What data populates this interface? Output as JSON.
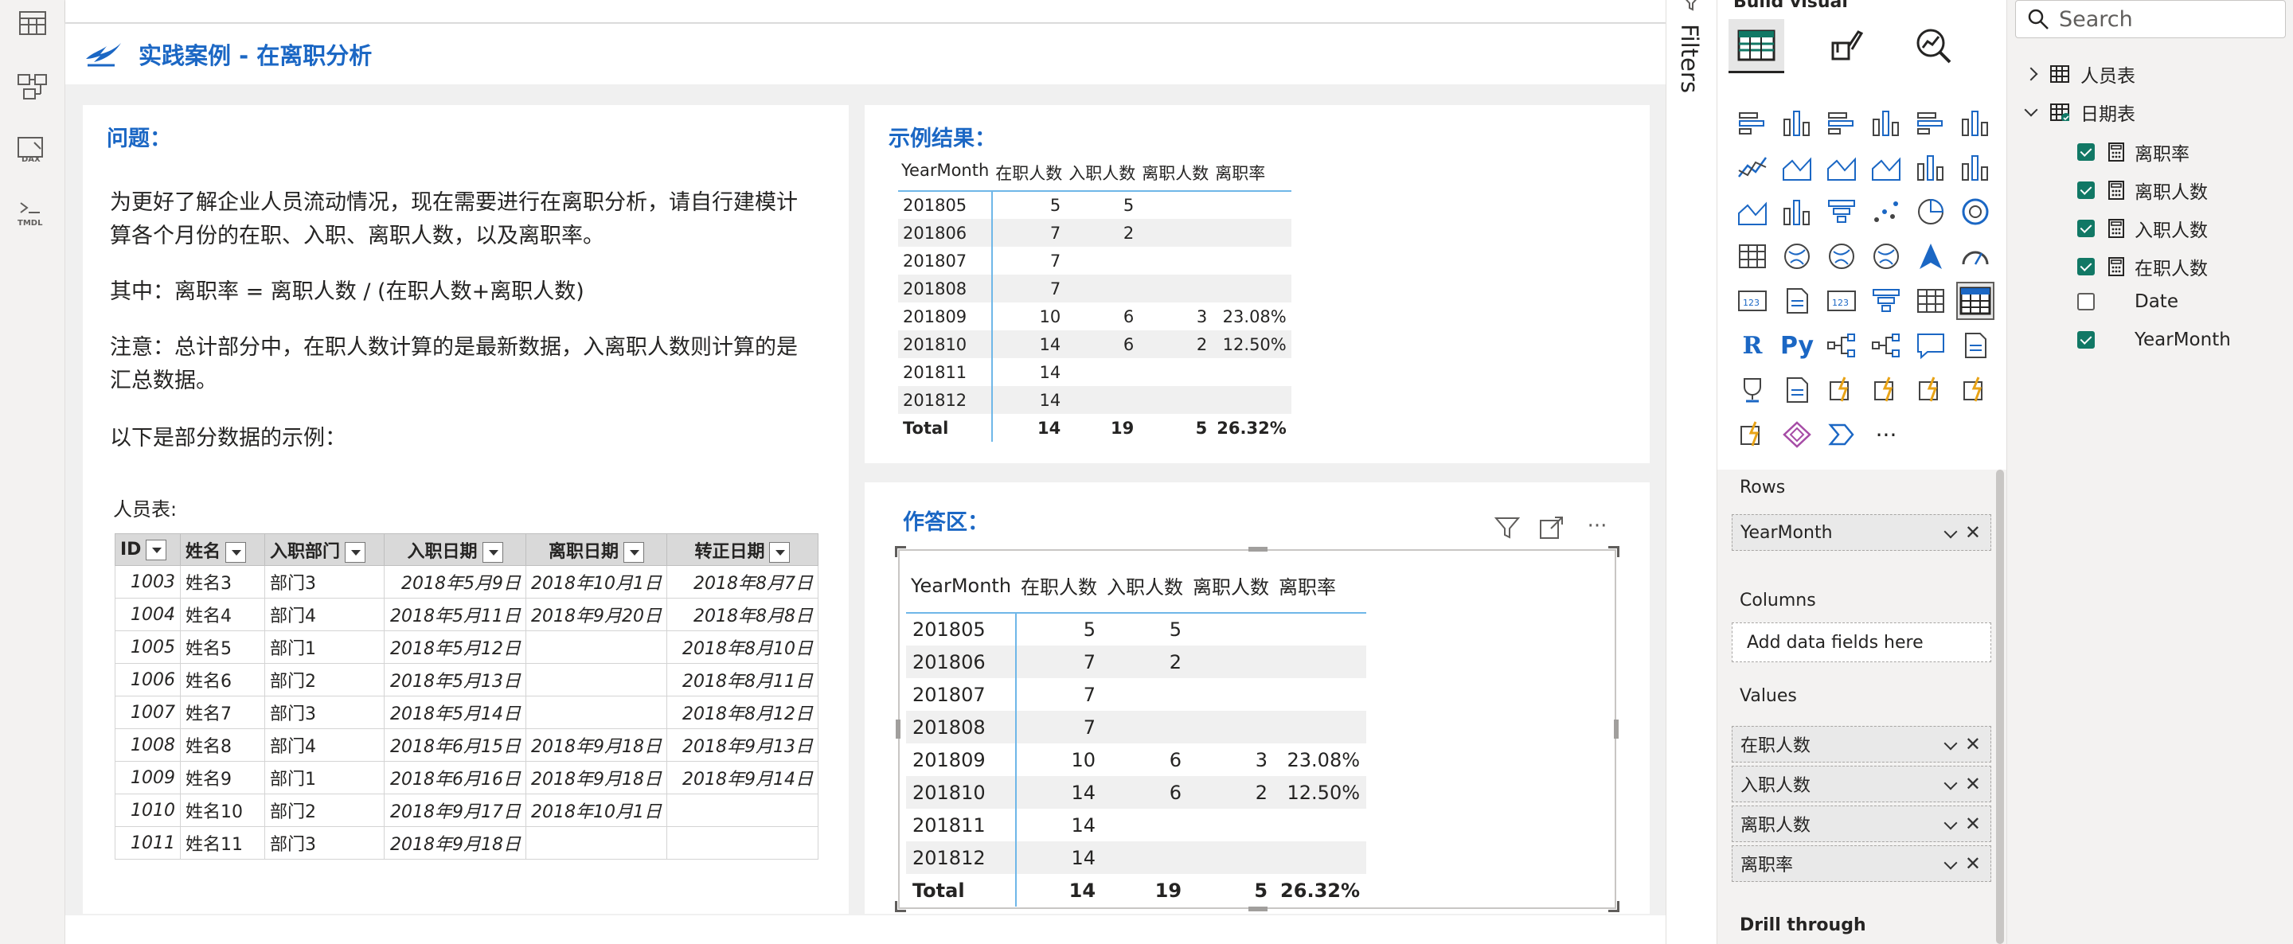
{
  "page": {
    "title": "实践案例 - 在离职分析"
  },
  "question": {
    "title": "问题：",
    "p1": "为更好了解企业人员流动情况，现在需要进行在离职分析，请自行建模计算各个月份的在职、入职、离职人数，以及离职率。",
    "p2": "其中：离职率 = 离职人数 / (在职人数+离职人数)",
    "p3": "注意：总计部分中，在职人数计算的是最新数据，入离职人数则计算的是汇总数据。",
    "p4": "以下是部分数据的示例：",
    "emp_caption": "人员表:",
    "emp_headers": [
      "ID",
      "姓名",
      "入职部门",
      "入职日期",
      "离职日期",
      "转正日期"
    ],
    "emp_rows": [
      [
        "1003",
        "姓名3",
        "部门3",
        "2018年5月9日",
        "2018年10月1日",
        "2018年8月7日"
      ],
      [
        "1004",
        "姓名4",
        "部门4",
        "2018年5月11日",
        "2018年9月20日",
        "2018年8月8日"
      ],
      [
        "1005",
        "姓名5",
        "部门1",
        "2018年5月12日",
        "",
        "2018年8月10日"
      ],
      [
        "1006",
        "姓名6",
        "部门2",
        "2018年5月13日",
        "",
        "2018年8月11日"
      ],
      [
        "1007",
        "姓名7",
        "部门3",
        "2018年5月14日",
        "",
        "2018年8月12日"
      ],
      [
        "1008",
        "姓名8",
        "部门4",
        "2018年6月15日",
        "2018年9月18日",
        "2018年9月13日"
      ],
      [
        "1009",
        "姓名9",
        "部门1",
        "2018年6月16日",
        "2018年9月18日",
        "2018年9月14日"
      ],
      [
        "1010",
        "姓名10",
        "部门2",
        "2018年9月17日",
        "2018年10月1日",
        ""
      ],
      [
        "1011",
        "姓名11",
        "部门3",
        "2018年9月18日",
        "",
        ""
      ]
    ]
  },
  "sample": {
    "title": "示例结果：",
    "headers": [
      "YearMonth",
      "在职人数",
      "入职人数",
      "离职人数",
      "离职率"
    ],
    "rows": [
      [
        "201805",
        "5",
        "5",
        "",
        ""
      ],
      [
        "201806",
        "7",
        "2",
        "",
        ""
      ],
      [
        "201807",
        "7",
        "",
        "",
        ""
      ],
      [
        "201808",
        "7",
        "",
        "",
        ""
      ],
      [
        "201809",
        "10",
        "6",
        "3",
        "23.08%"
      ],
      [
        "201810",
        "14",
        "6",
        "2",
        "12.50%"
      ],
      [
        "201811",
        "14",
        "",
        "",
        ""
      ],
      [
        "201812",
        "14",
        "",
        "",
        ""
      ]
    ],
    "total": [
      "Total",
      "14",
      "19",
      "5",
      "26.32%"
    ]
  },
  "answer": {
    "title": "作答区：",
    "headers": [
      "YearMonth",
      "在职人数",
      "入职人数",
      "离职人数",
      "离职率"
    ],
    "rows": [
      [
        "201805",
        "5",
        "5",
        "",
        ""
      ],
      [
        "201806",
        "7",
        "2",
        "",
        ""
      ],
      [
        "201807",
        "7",
        "",
        "",
        ""
      ],
      [
        "201808",
        "7",
        "",
        "",
        ""
      ],
      [
        "201809",
        "10",
        "6",
        "3",
        "23.08%"
      ],
      [
        "201810",
        "14",
        "6",
        "2",
        "12.50%"
      ],
      [
        "201811",
        "14",
        "",
        "",
        ""
      ],
      [
        "201812",
        "14",
        "",
        "",
        ""
      ]
    ],
    "total": [
      "Total",
      "14",
      "19",
      "5",
      "26.32%"
    ]
  },
  "filters": {
    "label": "Filters"
  },
  "viz": {
    "header": "Build visual",
    "wells": {
      "rows_title": "Rows",
      "rows_fields": [
        "YearMonth"
      ],
      "columns_title": "Columns",
      "columns_placeholder": "Add data fields here",
      "values_title": "Values",
      "values_fields": [
        "在职人数",
        "入职人数",
        "离职人数",
        "离职率"
      ],
      "drill_title": "Drill through"
    },
    "text_icons": {
      "r": "R",
      "py": "Py",
      "more": "···"
    }
  },
  "data": {
    "search_placeholder": "Search",
    "tables": [
      {
        "name": "人员表",
        "expanded": false
      },
      {
        "name": "日期表",
        "expanded": true
      }
    ],
    "fields": [
      {
        "name": "离职率",
        "checked": true,
        "measure": true
      },
      {
        "name": "离职人数",
        "checked": true,
        "measure": true
      },
      {
        "name": "入职人数",
        "checked": true,
        "measure": true
      },
      {
        "name": "在职人数",
        "checked": true,
        "measure": true
      },
      {
        "name": "Date",
        "checked": false,
        "measure": false
      },
      {
        "name": "YearMonth",
        "checked": true,
        "measure": false
      }
    ]
  },
  "colors": {
    "accent_blue": "#1b67c4",
    "check_green": "#117865",
    "table_line_blue": "#6fb7e8"
  }
}
